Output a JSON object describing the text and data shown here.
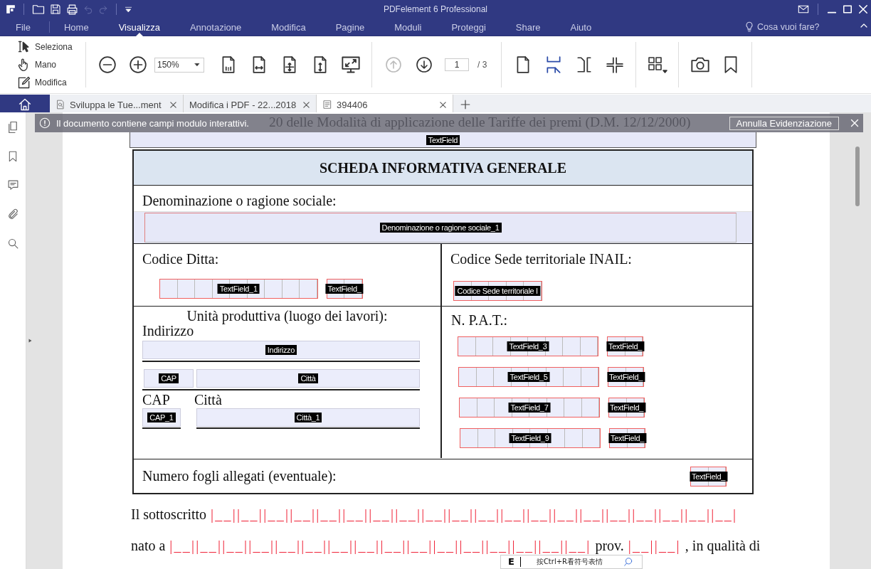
{
  "window": {
    "title": "PDFelement 6 Professional"
  },
  "menu": [
    {
      "label": "File",
      "selected": false
    },
    {
      "label": "Home",
      "selected": false
    },
    {
      "label": "Visualizza",
      "selected": true
    },
    {
      "label": "Annotazione",
      "selected": false
    },
    {
      "label": "Modifica",
      "selected": false
    },
    {
      "label": "Pagine",
      "selected": false
    },
    {
      "label": "Moduli",
      "selected": false
    },
    {
      "label": "Proteggi",
      "selected": false
    },
    {
      "label": "Share",
      "selected": false
    },
    {
      "label": "Aiuto",
      "selected": false
    }
  ],
  "help_search": {
    "placeholder": "Cosa vuoi fare?"
  },
  "toolbar": {
    "tools": [
      {
        "kind": "select",
        "label": "Seleziona"
      },
      {
        "kind": "hand",
        "label": "Mano"
      },
      {
        "kind": "edit",
        "label": "Modifica"
      }
    ],
    "zoom": "150%",
    "page": "1",
    "page_total": "/ 3",
    "layouts": [
      {
        "kind": "single",
        "selected": false
      },
      {
        "kind": "continuous",
        "selected": true
      },
      {
        "kind": "facing",
        "selected": false
      },
      {
        "kind": "facing_continuous",
        "selected": false
      }
    ]
  },
  "tabs": [
    {
      "kind": "search",
      "label": "Sviluppa le Tue...ment",
      "selected": false
    },
    {
      "kind": "page",
      "label": "Modifica i PDF - 22...2018",
      "selected": false
    },
    {
      "kind": "doc",
      "label": "394406",
      "selected": true
    }
  ],
  "banner": {
    "message": "Il documento contiene campi modulo interattivi.",
    "button": "Annulla Evidenziazione"
  },
  "document": {
    "top_line": "20 delle Modalità di applicazione delle Tariffe dei premi (D.M. 12/12/2000)",
    "top_field": "TextField",
    "heading": "SCHEDA INFORMATIVA GENERALE",
    "denominazione": {
      "label": "Denominazione o ragione sociale:",
      "field": "Denominazione o ragione sociale_1"
    },
    "codice_ditta": {
      "label": "Codice Ditta:",
      "fields": [
        {
          "kind": "comb9",
          "name": "TextField_1"
        },
        {
          "kind": "comb2",
          "name": "TextField_"
        }
      ]
    },
    "codice_sede": {
      "label": "Codice Sede territoriale INAIL:",
      "fields": [
        {
          "kind": "comb5",
          "name": "Codice Sede territoriale I"
        }
      ]
    },
    "unita": {
      "title": "Unità produttiva (luogo dei lavori):",
      "address_label": "Indirizzo",
      "address_field": "Indirizzo",
      "cap_field": "CAP",
      "city_field": "Città",
      "cap_label": "CAP",
      "city_label": "Città",
      "cap_field_2": "CAP_1",
      "city_field_2": "Città_1"
    },
    "npat": {
      "label": "N. P.A.T.:",
      "rows": [
        {
          "main": "TextField_3",
          "side": "TextField_"
        },
        {
          "main": "TextField_5",
          "side": "TextField_"
        },
        {
          "main": "TextField_7",
          "side": "TextField_"
        },
        {
          "main": "TextField_9",
          "side": "TextField_"
        }
      ]
    },
    "fogli": {
      "label": "Numero fogli allegati (eventuale):",
      "field": "TextField_"
    },
    "lines": [
      {
        "parts": [
          {
            "kind": "text",
            "text": "Il sottoscritto"
          },
          {
            "kind": "boxes",
            "text": "|__||__||__||__||__||__||__||__||__||__||__||__||__||__||__||__||__||__||__||__|"
          }
        ]
      },
      {
        "parts": [
          {
            "kind": "text",
            "text": "nato a"
          },
          {
            "kind": "boxes",
            "text": "|__||__||__||__||__||__||__||__||__||__||__||__||__||__||__||__|"
          },
          {
            "kind": "text",
            "text": "prov."
          },
          {
            "kind": "boxes",
            "text": "|__||__|"
          },
          {
            "kind": "text",
            "text": ", in qualità di"
          }
        ]
      }
    ]
  },
  "ime": {
    "mode": "E",
    "hint": "按Ctrl+R看符号表情"
  }
}
